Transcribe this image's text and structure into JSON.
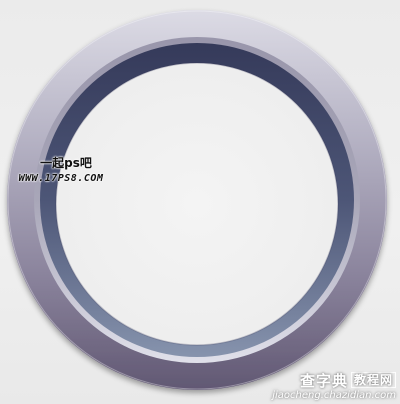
{
  "watermark_left": {
    "line1": "一起ps吧",
    "line2": "WWW.17PS8.COM"
  },
  "watermark_right": {
    "line1": "查字典",
    "line1_boxed": "教程网",
    "line2": "jiaocheng.chazidian.com"
  },
  "colors": {
    "background": "#ececec",
    "ring_outer_light": "#d7d6e1",
    "ring_outer_dark": "#5c5470",
    "ring_inner_dark": "#3a3f5e",
    "ring_inner_light": "#8a96b0",
    "center": "#f1f1f1"
  }
}
